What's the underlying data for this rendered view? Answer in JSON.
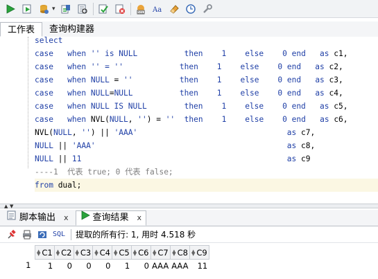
{
  "top_tabs": [
    "工作表",
    "查询构建器"
  ],
  "editor": {
    "lines": [
      [
        [
          "kw",
          "select"
        ]
      ],
      [
        [
          "kw",
          "case"
        ],
        [
          "",
          "   "
        ],
        [
          "kw",
          "when"
        ],
        [
          "str",
          " '' "
        ],
        [
          "kw",
          "is NULL"
        ],
        [
          "",
          "          "
        ],
        [
          "kw",
          "then"
        ],
        [
          "",
          "    "
        ],
        [
          "kw",
          "1"
        ],
        [
          "",
          "    "
        ],
        [
          "kw",
          "else"
        ],
        [
          "",
          "    "
        ],
        [
          "kw",
          "0"
        ],
        [
          "",
          ""
        ],
        [
          "kw",
          " end"
        ],
        [
          "",
          "   "
        ],
        [
          "kw",
          "as"
        ],
        [
          "",
          " c1,"
        ]
      ],
      [
        [
          "kw",
          "case"
        ],
        [
          "",
          "   "
        ],
        [
          "kw",
          "when"
        ],
        [
          "str",
          " '' "
        ],
        [
          "kw",
          "= ''"
        ],
        [
          "",
          "            "
        ],
        [
          "kw",
          "then"
        ],
        [
          "",
          "    "
        ],
        [
          "kw",
          "1"
        ],
        [
          "",
          "    "
        ],
        [
          "kw",
          "else"
        ],
        [
          "",
          "    "
        ],
        [
          "kw",
          "0"
        ],
        [
          "",
          ""
        ],
        [
          "kw",
          " end"
        ],
        [
          "",
          "   "
        ],
        [
          "kw",
          "as"
        ],
        [
          "",
          " c2,"
        ]
      ],
      [
        [
          "kw",
          "case"
        ],
        [
          "",
          "   "
        ],
        [
          "kw",
          "when"
        ],
        [
          "kw",
          " NULL"
        ],
        [
          "",
          " = "
        ],
        [
          "str",
          "''"
        ],
        [
          "",
          "          "
        ],
        [
          "kw",
          "then"
        ],
        [
          "",
          "    "
        ],
        [
          "kw",
          "1"
        ],
        [
          "",
          "    "
        ],
        [
          "kw",
          "else"
        ],
        [
          "",
          "    "
        ],
        [
          "kw",
          "0"
        ],
        [
          "",
          ""
        ],
        [
          "kw",
          " end"
        ],
        [
          "",
          "   "
        ],
        [
          "kw",
          "as"
        ],
        [
          "",
          " c3,"
        ]
      ],
      [
        [
          "kw",
          "case"
        ],
        [
          "",
          "   "
        ],
        [
          "kw",
          "when"
        ],
        [
          "kw",
          " NULL"
        ],
        [
          "",
          "="
        ],
        [
          "kw",
          "NULL"
        ],
        [
          "",
          "          "
        ],
        [
          "kw",
          "then"
        ],
        [
          "",
          "    "
        ],
        [
          "kw",
          "1"
        ],
        [
          "",
          "    "
        ],
        [
          "kw",
          "else"
        ],
        [
          "",
          "    "
        ],
        [
          "kw",
          "0"
        ],
        [
          "",
          ""
        ],
        [
          "kw",
          " end"
        ],
        [
          "",
          "   "
        ],
        [
          "kw",
          "as"
        ],
        [
          "",
          " c4,"
        ]
      ],
      [
        [
          "kw",
          "case"
        ],
        [
          "",
          "   "
        ],
        [
          "kw",
          "when"
        ],
        [
          "kw",
          " NULL IS NULL"
        ],
        [
          "",
          "        "
        ],
        [
          "kw",
          "then"
        ],
        [
          "",
          "    "
        ],
        [
          "kw",
          "1"
        ],
        [
          "",
          "    "
        ],
        [
          "kw",
          "else"
        ],
        [
          "",
          "    "
        ],
        [
          "kw",
          "0"
        ],
        [
          "",
          ""
        ],
        [
          "kw",
          " end"
        ],
        [
          "",
          "   "
        ],
        [
          "kw",
          "as"
        ],
        [
          "",
          " c5,"
        ]
      ],
      [
        [
          "kw",
          "case"
        ],
        [
          "",
          "   "
        ],
        [
          "kw",
          "when"
        ],
        [
          "",
          " NVL("
        ],
        [
          "kw",
          "NULL"
        ],
        [
          "",
          ", "
        ],
        [
          "str",
          "''"
        ],
        [
          "",
          ") = "
        ],
        [
          "str",
          "''"
        ],
        [
          "",
          "  "
        ],
        [
          "kw",
          "then"
        ],
        [
          "",
          "    "
        ],
        [
          "kw",
          "1"
        ],
        [
          "",
          "    "
        ],
        [
          "kw",
          "else"
        ],
        [
          "",
          "    "
        ],
        [
          "kw",
          "0"
        ],
        [
          "",
          ""
        ],
        [
          "kw",
          " end"
        ],
        [
          "",
          "   "
        ],
        [
          "kw",
          "as"
        ],
        [
          "",
          " c6,"
        ]
      ],
      [
        [
          "",
          "NVL("
        ],
        [
          "kw",
          "NULL"
        ],
        [
          "",
          ", "
        ],
        [
          "str",
          "''"
        ],
        [
          "",
          ") || "
        ],
        [
          "str",
          "'AAA'"
        ],
        [
          "",
          "                                "
        ],
        [
          "kw",
          "as"
        ],
        [
          "",
          " c7,"
        ]
      ],
      [
        [
          "kw",
          "NULL"
        ],
        [
          "",
          " || "
        ],
        [
          "str",
          "'AAA'"
        ],
        [
          "",
          "                                         "
        ],
        [
          "kw",
          "as"
        ],
        [
          "",
          " c8,"
        ]
      ],
      [
        [
          "kw",
          "NULL"
        ],
        [
          "",
          " || "
        ],
        [
          "kw",
          "11"
        ],
        [
          "",
          "                                            "
        ],
        [
          "kw",
          "as"
        ],
        [
          "",
          " c9"
        ]
      ],
      [
        [
          "cmt",
          "----1  代表 true; 0 代表 false;"
        ]
      ],
      [
        [
          "kw",
          "from"
        ],
        [
          "",
          " dual;"
        ]
      ]
    ]
  },
  "bottom_tabs": {
    "script_output": "脚本输出",
    "query_result": "查询结果",
    "close": "x"
  },
  "result_toolbar": {
    "sql_label": "SQL",
    "status": "提取的所有行: 1, 用时 4.518 秒"
  },
  "grid": {
    "columns": [
      "C1",
      "C2",
      "C3",
      "C4",
      "C5",
      "C6",
      "C7",
      "C8",
      "C9"
    ],
    "rows": [
      {
        "num": "1",
        "cells": [
          "1",
          "0",
          "0",
          "0",
          "1",
          "0",
          "AAA",
          "AAA",
          "11"
        ]
      }
    ]
  },
  "icons": [
    "run-icon",
    "run-script-icon",
    "commit-icon",
    "autotrace-icon",
    "explain-plan-icon",
    "sql-tuning-icon",
    "clear-icon",
    "history-icon",
    "format-icon",
    "eraser-icon",
    "find-icon",
    "wrench-icon",
    "pin-icon",
    "print-icon",
    "refresh-icon"
  ]
}
